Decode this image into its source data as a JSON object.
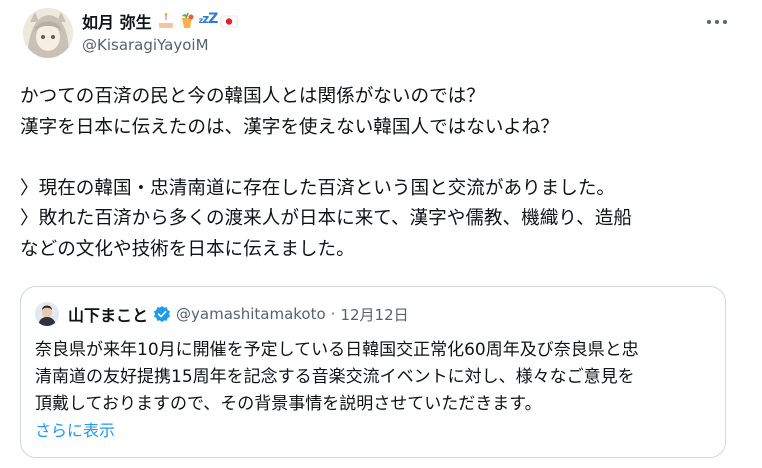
{
  "author": {
    "display_name": "如月 弥生",
    "handle": "@KisaragiYayoiM",
    "name_emojis": [
      "cake-emoji",
      "tropical-drink-emoji",
      "sleeping-zzz-emoji",
      "japan-flag-emoji"
    ]
  },
  "tweet": {
    "lines": [
      "かつての百済の民と今の韓国人とは関係がないのでは？",
      "漢字を日本に伝えたのは、漢字を使えない韓国人ではないよね？",
      "",
      "〉現在の韓国・忠清南道に存在した百済という国と交流がありました。",
      "〉敗れた百済から多くの渡来人が日本に来て、漢字や儒教、機織り、造船",
      "などの文化や技術を日本に伝えました。"
    ]
  },
  "quoted_tweet": {
    "display_name": "山下まこと",
    "verified": true,
    "handle": "@yamashitamakoto",
    "separator": "·",
    "date": "12月12日",
    "lines": [
      "奈良県が来年10月に開催を予定している日韓国交正常化60周年及び奈良県と忠",
      "清南道の友好提携15周年を記念する音楽交流イベントに対し、様々なご意見を",
      "頂戴しておりますので、その背景事情を説明させていただきます。"
    ],
    "show_more_label": "さらに表示"
  },
  "colors": {
    "text": "#0f1419",
    "secondary": "#536471",
    "link": "#1d9bf0",
    "verified_badge": "#1d9bf0",
    "border": "#cfd9de"
  }
}
